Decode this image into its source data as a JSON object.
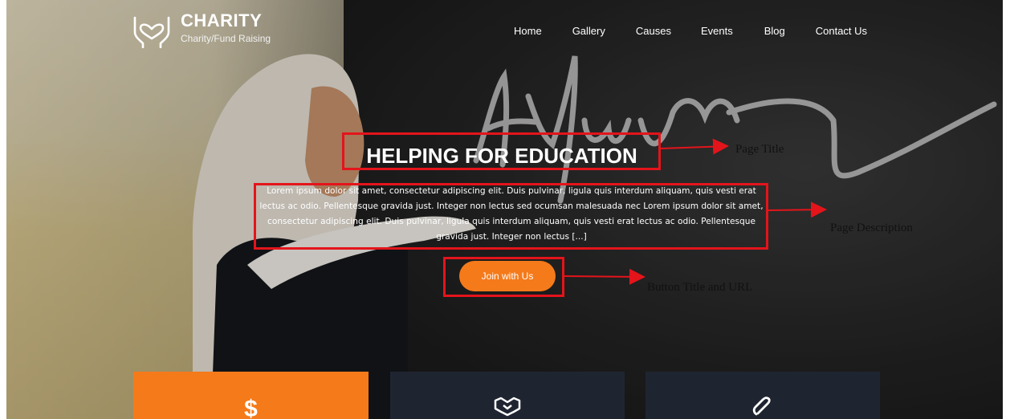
{
  "brand": {
    "title": "CHARITY",
    "subtitle": "Charity/Fund Raising",
    "icon": "heart-hands-icon"
  },
  "nav": {
    "items": [
      "Home",
      "Gallery",
      "Causes",
      "Events",
      "Blog",
      "Contact Us"
    ]
  },
  "hero": {
    "title": "HELPING FOR EDUCATION",
    "description": "Lorem ipsum dolor sit amet, consectetur adipiscing elit. Duis pulvinar, ligula quis interdum aliquam, quis vesti erat lectus ac odio. Pellentesque gravida just. Integer non lectus sed ocumsan malesuada nec Lorem ipsum dolor sit amet, consectetur adipiscing elit. Duis pulvinar, ligula quis interdum aliquam, quis vesti erat lectus ac odio. Pellentesque gravida just. Integer non lectus [...]",
    "button": "Join with Us",
    "chalk_text": "Asylum"
  },
  "annotations": {
    "title": "Page Title",
    "description": "Page Description",
    "button": "Button Title and URL"
  },
  "cards": [
    {
      "icon": "dollar-icon",
      "symbol": "$"
    },
    {
      "icon": "handshake-icon"
    },
    {
      "icon": "paperclip-icon"
    }
  ],
  "colors": {
    "accent": "#f57a1a",
    "card_dark": "#1f2530",
    "annotation": "#e4141b"
  }
}
